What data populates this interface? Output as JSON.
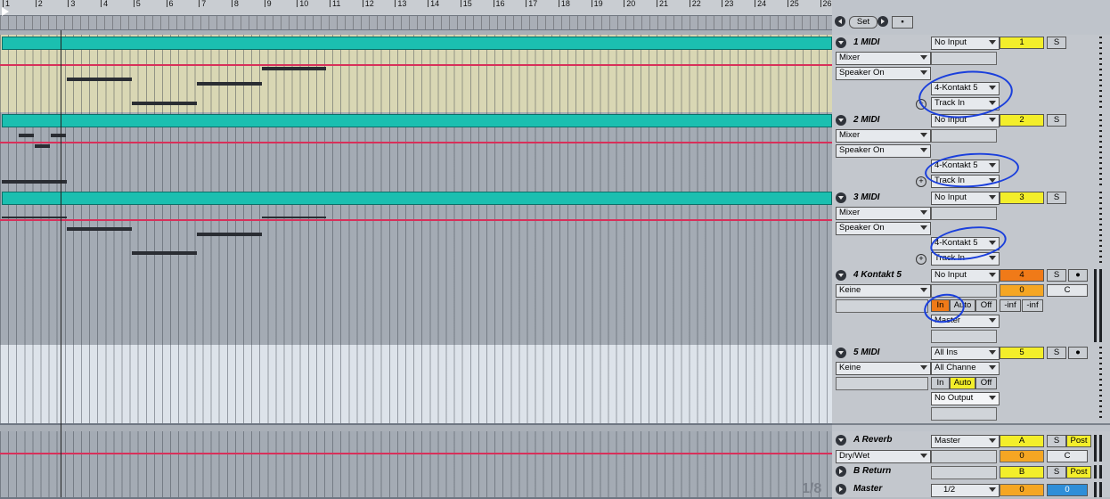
{
  "ruler": {
    "bars": [
      "1",
      "2",
      "3",
      "4",
      "5",
      "6",
      "7",
      "8",
      "9",
      "10",
      "11",
      "12",
      "13",
      "14",
      "15",
      "16",
      "17",
      "18",
      "19",
      "20",
      "21",
      "22",
      "23",
      "24",
      "25",
      "26"
    ]
  },
  "transport": {
    "set_label": "Set"
  },
  "tracks": [
    {
      "name": "1 MIDI",
      "input": "No Input",
      "sub1": "Mixer",
      "sub2": "Speaker On",
      "output": "4-Kontakt 5",
      "output2": "Track In",
      "number": "1",
      "solo": "S"
    },
    {
      "name": "2 MIDI",
      "input": "No Input",
      "sub1": "Mixer",
      "sub2": "Speaker On",
      "output": "4-Kontakt 5",
      "output2": "Track In",
      "number": "2",
      "solo": "S"
    },
    {
      "name": "3 MIDI",
      "input": "No Input",
      "sub1": "Mixer",
      "sub2": "Speaker On",
      "output": "4-Kontakt 5",
      "output2": "Track In",
      "number": "3",
      "solo": "S"
    },
    {
      "name": "4 Kontakt 5",
      "input": "No Input",
      "sub1": "Keine",
      "monitor": [
        "In",
        "Auto",
        "Off"
      ],
      "output": "Master",
      "number": "4",
      "solo": "S",
      "volume": "0",
      "pan": "C",
      "inf1": "-inf",
      "inf2": "-inf"
    },
    {
      "name": "5 MIDI",
      "input": "All Ins",
      "sub1": "Keine",
      "channel": "All Channe",
      "monitor": [
        "In",
        "Auto",
        "Off"
      ],
      "output": "No Output",
      "number": "5",
      "solo": "S"
    }
  ],
  "returns": [
    {
      "name": "A Reverb",
      "output": "Master",
      "sub1": "Dry/Wet",
      "letter": "A",
      "solo": "S",
      "post": "Post",
      "volume": "0",
      "pan": "C"
    },
    {
      "name": "B Return",
      "letter": "B",
      "solo": "S",
      "post": "Post"
    }
  ],
  "master": {
    "name": "Master",
    "output": "1/2",
    "volume": "0",
    "cue": "0"
  },
  "page_number": "1/8",
  "colors": {
    "clip": "#1bbfb0",
    "midi_lane": "#d9d7b4",
    "selected": "#f3ee2a",
    "armed": "#f07a18",
    "annotation": "#1a3fdc"
  }
}
